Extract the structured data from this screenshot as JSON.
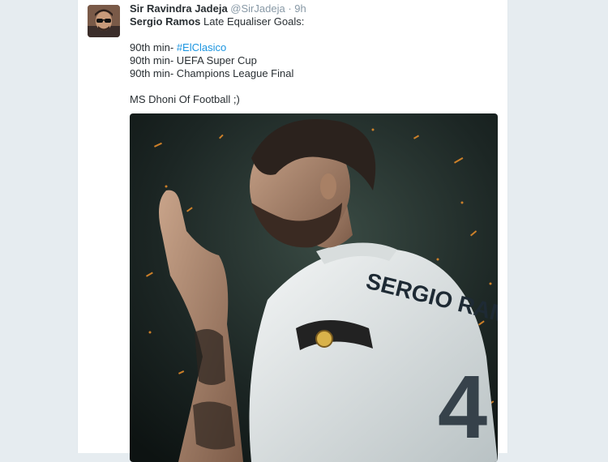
{
  "tweet": {
    "author_name": "Sir Ravindra Jadeja",
    "author_handle": "@SirJadeja",
    "separator": "·",
    "timestamp": "9h",
    "line1_bold": "Sergio Ramos",
    "line1_rest": " Late Equaliser Goals:",
    "goal1_prefix": "90th min- ",
    "goal1_hashtag": "#ElClasico",
    "goal2": "90th min- UEFA Super Cup",
    "goal3": "90th min- Champions League Final",
    "closing": "MS Dhoni Of Football ;)"
  },
  "media": {
    "jersey_text": "SERGIO RAMOS",
    "jersey_number": "4"
  },
  "colors": {
    "link": "#1b95e0",
    "text": "#292f33",
    "muted": "#8899a6",
    "background": "#e6ecf0"
  }
}
